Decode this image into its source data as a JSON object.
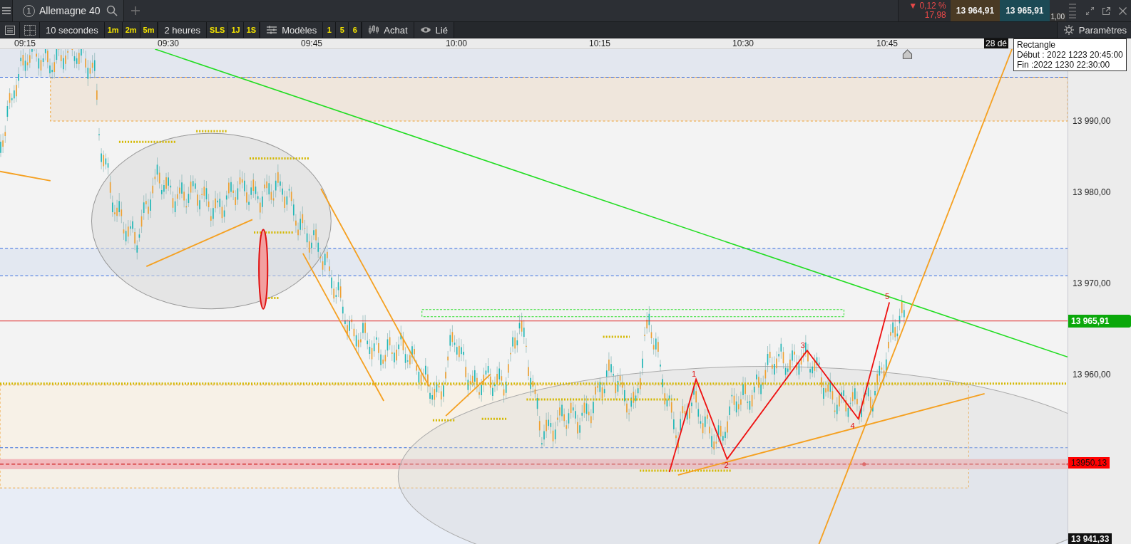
{
  "top_bar": {
    "tab": {
      "number": "1",
      "label": "Allemagne 40"
    },
    "change": {
      "percent": "▼ 0,12 %",
      "points": "17,98"
    },
    "bid": "13 964,91",
    "ask": "13 965,91",
    "spread": "1,00"
  },
  "toolbar": {
    "interval": "10 secondes",
    "quick_intervals": [
      "1m",
      "2m",
      "5m"
    ],
    "range": "2 heures",
    "quick_ranges": [
      "SLS",
      "1J",
      "1S"
    ],
    "templates": "Modèles",
    "quick_templates": [
      "1",
      "5",
      "6"
    ],
    "order": "Achat",
    "link": "Lié",
    "settings": "Paramètres"
  },
  "time_axis": [
    "09:15",
    "09:30",
    "09:45",
    "10:00",
    "10:15",
    "10:30",
    "10:45"
  ],
  "price_axis": [
    "13 990,00",
    "13 980,00",
    "13 970,00",
    "13 960,00"
  ],
  "price_tags": [
    {
      "kind": "last",
      "text": "13 965,91"
    },
    {
      "kind": "alert",
      "text": "13950.13"
    },
    {
      "kind": "low",
      "text": "13 941,33"
    }
  ],
  "wave_labels": [
    "1",
    "2",
    "3",
    "4",
    "5"
  ],
  "date_tag": "28 dé",
  "tooltip": {
    "title": "Rectangle",
    "lines": [
      "Début : 2022 1223 20:45:00",
      "Fin :2022 1230 22:30:00"
    ]
  }
}
